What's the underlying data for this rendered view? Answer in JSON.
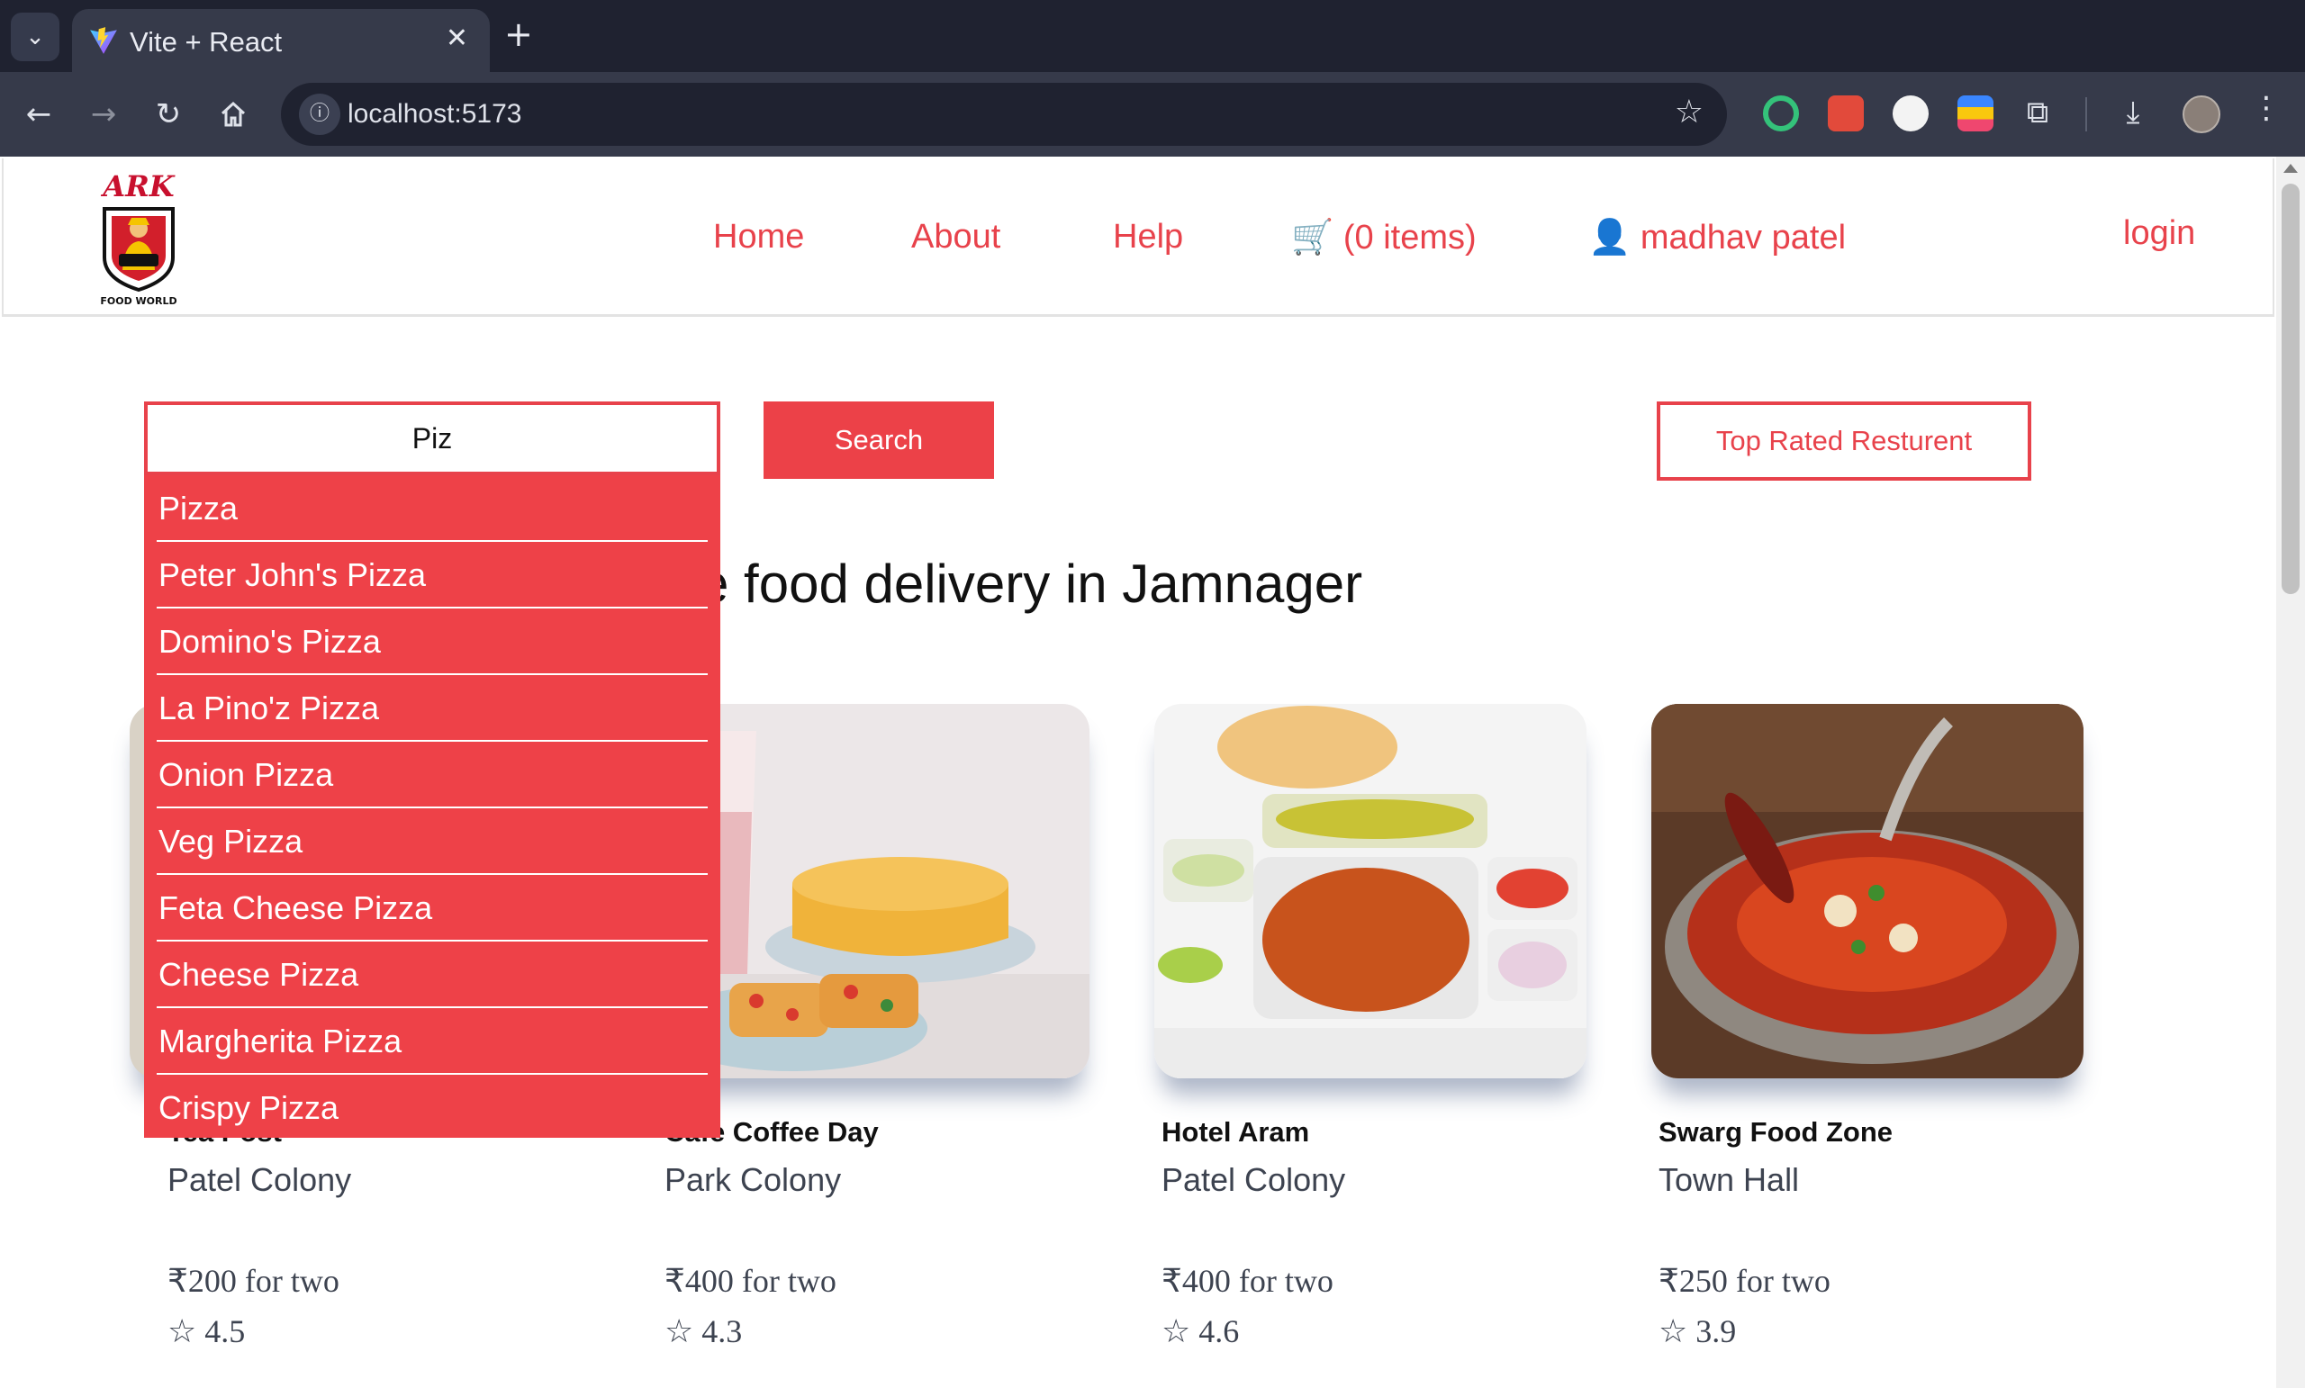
{
  "browser": {
    "tab_title": "Vite + React",
    "url": "localhost:5173"
  },
  "header": {
    "logo_text": "ARK",
    "logo_subtext": "FOOD WORLD",
    "nav": {
      "home": "Home",
      "about": "About",
      "help": "Help",
      "cart": "🛒 (0 items)",
      "user": "👤 madhav patel",
      "login": "login"
    }
  },
  "search": {
    "value": "Piz",
    "button_label": "Search",
    "top_rated_label": "Top Rated Resturent",
    "suggestions": [
      "Pizza",
      "Peter John's Pizza",
      "Domino's Pizza",
      "La Pino'z Pizza",
      "Onion Pizza",
      "Veg Pizza",
      "Feta Cheese Pizza",
      "Cheese Pizza",
      "Margherita Pizza",
      "Crispy Pizza"
    ]
  },
  "main": {
    "heading_visible": "e food delivery in Jamnager",
    "restaurants": [
      {
        "name": "Tea Post",
        "area": "Patel Colony",
        "price": "₹200 for two",
        "rating": "☆ 4.5"
      },
      {
        "name": "Cafe Coffee Day",
        "area": "Park Colony",
        "price": "₹400 for two",
        "rating": "☆ 4.3"
      },
      {
        "name": "Hotel Aram",
        "area": "Patel Colony",
        "price": "₹400 for two",
        "rating": "☆ 4.6"
      },
      {
        "name": "Swarg Food Zone",
        "area": "Town Hall",
        "price": "₹250 for two",
        "rating": "☆ 3.9"
      }
    ]
  },
  "colors": {
    "brand_red": "#ec4148",
    "chrome_dark": "#1f2230",
    "chrome_toolbar": "#363a4a"
  }
}
